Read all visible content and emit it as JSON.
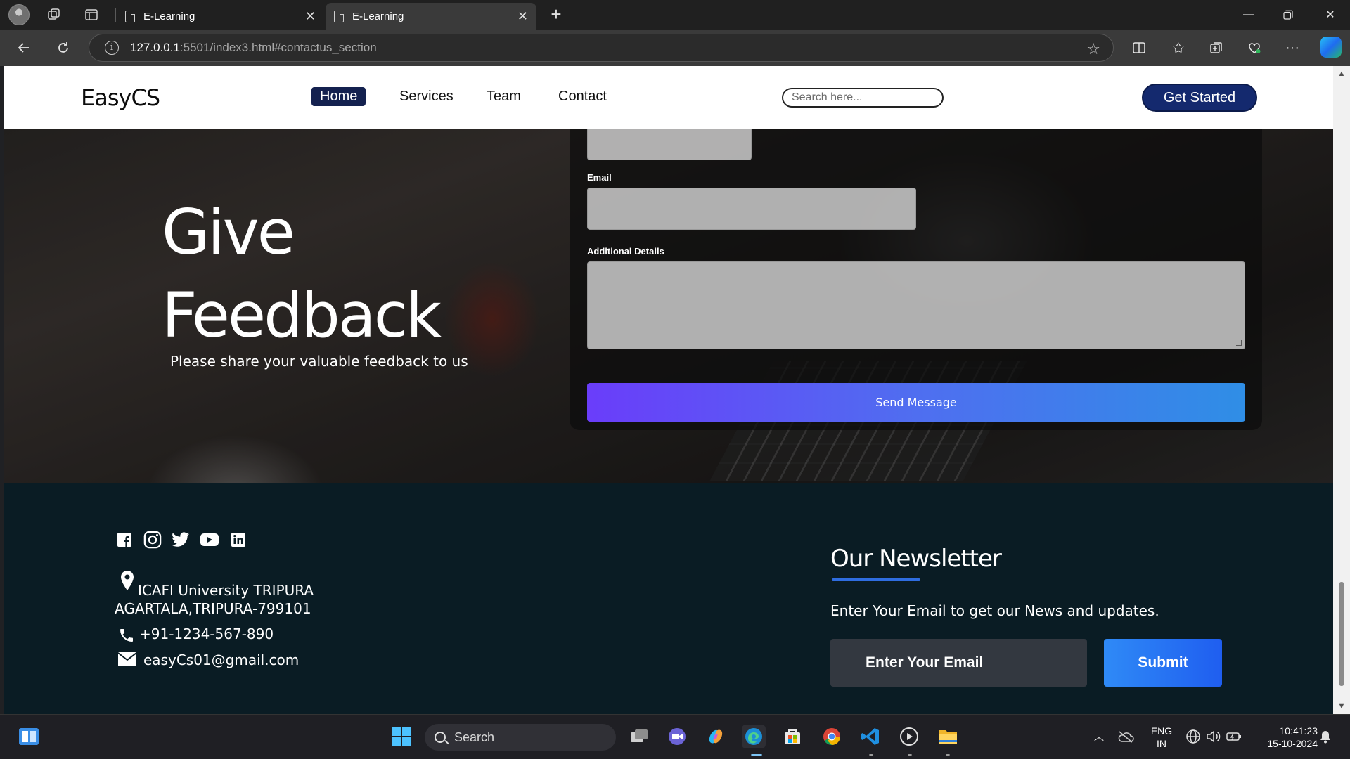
{
  "browser": {
    "tabs": [
      {
        "title": "E-Learning",
        "active": false
      },
      {
        "title": "E-Learning",
        "active": true
      }
    ],
    "address": {
      "host": "127.0.0.1",
      "rest": ":5501/index3.html#contactus_section"
    }
  },
  "navbar": {
    "logo": "EasyCS",
    "links": [
      "Home",
      "Services",
      "Team",
      "Contact"
    ],
    "active_link": "Home",
    "search_placeholder": "Search here...",
    "cta_label": "Get Started",
    "colors": {
      "active": "#14214f",
      "cta": "#14296e"
    }
  },
  "feedback": {
    "title_line1": "Give",
    "title_line2": "Feedback",
    "subtitle": "Please share your valuable feedback to us",
    "email_label": "Email",
    "details_label": "Additional Details",
    "send_label": "Send Message"
  },
  "footer": {
    "social_icons": [
      "facebook-icon",
      "instagram-icon",
      "twitter-icon",
      "youtube-icon",
      "linkedin-icon"
    ],
    "address_line1": "ICAFI University TRIPURA",
    "address_line2": "AGARTALA,TRIPURA-799101",
    "phone": "+91-1234-567-890",
    "email": "easyCs01@gmail.com",
    "newsletter": {
      "title": "Our Newsletter",
      "text": "Enter Your Email to get our News and updates.",
      "input_placeholder": "Enter Your Email",
      "submit_label": "Submit"
    }
  },
  "taskbar": {
    "search_label": "Search",
    "lang_line1": "ENG",
    "lang_line2": "IN",
    "time": "10:41:23",
    "date": "15-10-2024"
  }
}
